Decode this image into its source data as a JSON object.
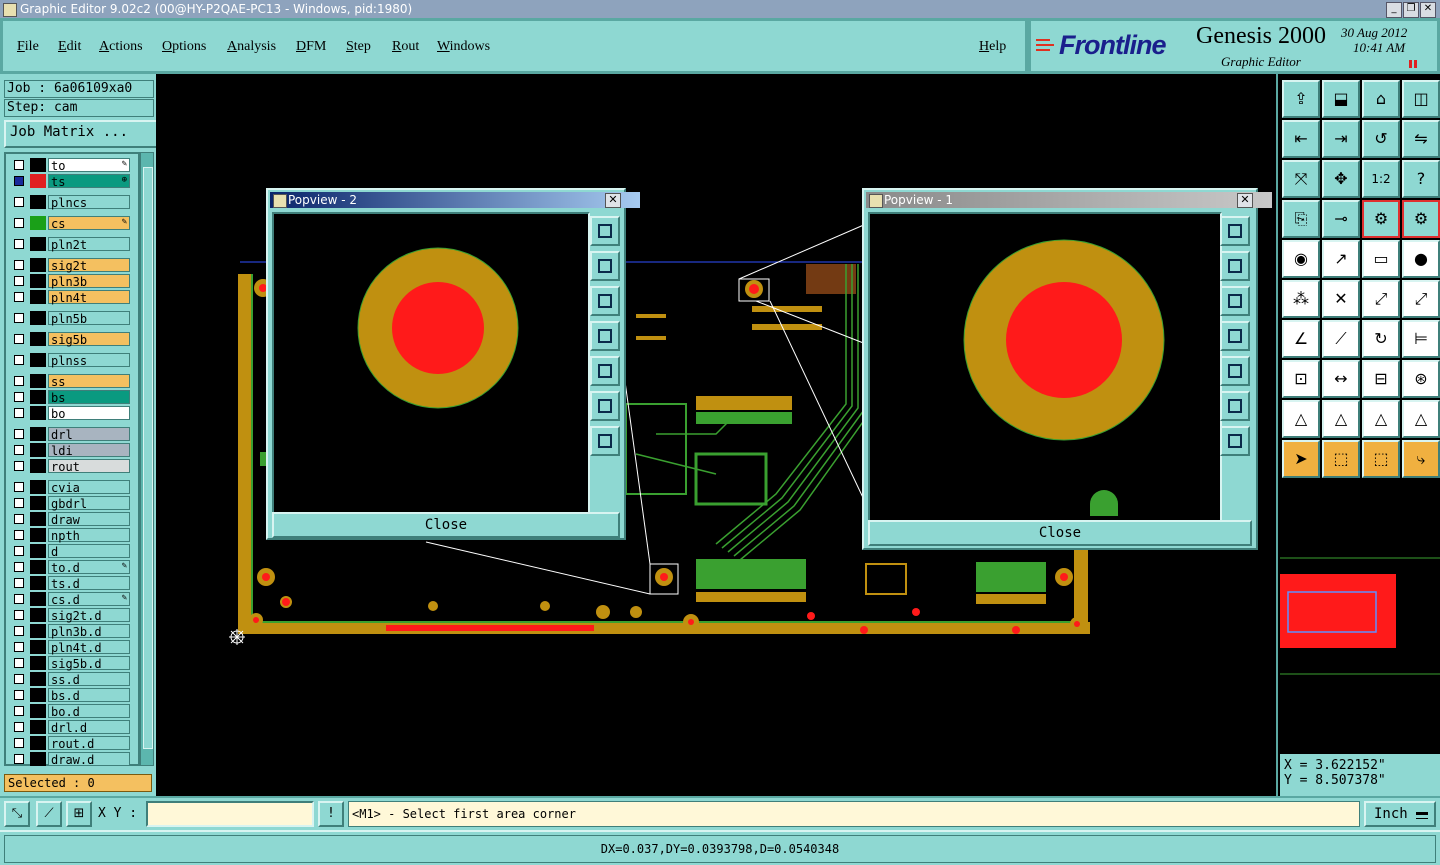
{
  "window": {
    "title": "Graphic Editor 9.02c2 (00@HY-P2QAE-PC13 - Windows, pid:1980)"
  },
  "menu": {
    "items": [
      "File",
      "Edit",
      "Actions",
      "Options",
      "Analysis",
      "DFM",
      "Step",
      "Rout",
      "Windows"
    ],
    "help": "Help"
  },
  "brand": {
    "logo": "Frontline",
    "product": "Genesis 2000",
    "subtitle": "Graphic Editor",
    "date": "30 Aug 2012",
    "time": "10:41 AM"
  },
  "job": {
    "job_label": "Job : 6a06109xa0",
    "step_label": "Step: cam",
    "matrix_button": "Job Matrix ..."
  },
  "layers": [
    {
      "name": "to",
      "color": "#000000",
      "bg": "#ffffff",
      "mark": "edit"
    },
    {
      "name": "ts",
      "color": "#e02020",
      "bg": "#0a9a80",
      "mark": "work"
    },
    {
      "name": "plncs",
      "color": "#000000",
      "bg": "#8ed8d2"
    },
    {
      "name": "cs",
      "color": "#1aa018",
      "bg": "#f4c060",
      "mark": "edit"
    },
    {
      "name": "pln2t",
      "color": "#000000",
      "bg": "#8ed8d2"
    },
    {
      "name": "sig2t",
      "color": "#000000",
      "bg": "#f4c060"
    },
    {
      "name": "pln3b",
      "color": "#000000",
      "bg": "#f4c060"
    },
    {
      "name": "pln4t",
      "color": "#000000",
      "bg": "#f4c060"
    },
    {
      "name": "pln5b",
      "color": "#000000",
      "bg": "#8ed8d2"
    },
    {
      "name": "sig5b",
      "color": "#000000",
      "bg": "#f4c060"
    },
    {
      "name": "plnss",
      "color": "#000000",
      "bg": "#8ed8d2"
    },
    {
      "name": "ss",
      "color": "#000000",
      "bg": "#f4c060"
    },
    {
      "name": "bs",
      "color": "#000000",
      "bg": "#0a9a80"
    },
    {
      "name": "bo",
      "color": "#000000",
      "bg": "#ffffff"
    },
    {
      "name": "drl",
      "color": "#000000",
      "bg": "#a8b4c0"
    },
    {
      "name": "ldi",
      "color": "#000000",
      "bg": "#a8b4c0"
    },
    {
      "name": "rout",
      "color": "#000000",
      "bg": "#d8dcdc"
    },
    {
      "name": "cvia",
      "color": "#000000",
      "bg": "#8ed8d2"
    },
    {
      "name": "gbdrl",
      "color": "#000000",
      "bg": "#8ed8d2"
    },
    {
      "name": "draw",
      "color": "#000000",
      "bg": "#8ed8d2"
    },
    {
      "name": "npth",
      "color": "#000000",
      "bg": "#8ed8d2"
    },
    {
      "name": "d",
      "color": "#000000",
      "bg": "#8ed8d2"
    },
    {
      "name": "to.d",
      "color": "#000000",
      "bg": "#8ed8d2",
      "mark": "edit"
    },
    {
      "name": "ts.d",
      "color": "#000000",
      "bg": "#8ed8d2"
    },
    {
      "name": "cs.d",
      "color": "#000000",
      "bg": "#8ed8d2",
      "mark": "edit"
    },
    {
      "name": "sig2t.d",
      "color": "#000000",
      "bg": "#8ed8d2"
    },
    {
      "name": "pln3b.d",
      "color": "#000000",
      "bg": "#8ed8d2"
    },
    {
      "name": "pln4t.d",
      "color": "#000000",
      "bg": "#8ed8d2"
    },
    {
      "name": "sig5b.d",
      "color": "#000000",
      "bg": "#8ed8d2"
    },
    {
      "name": "ss.d",
      "color": "#000000",
      "bg": "#8ed8d2"
    },
    {
      "name": "bs.d",
      "color": "#000000",
      "bg": "#8ed8d2"
    },
    {
      "name": "bo.d",
      "color": "#000000",
      "bg": "#8ed8d2"
    },
    {
      "name": "drl.d",
      "color": "#000000",
      "bg": "#8ed8d2"
    },
    {
      "name": "rout.d",
      "color": "#000000",
      "bg": "#8ed8d2"
    },
    {
      "name": "draw.d",
      "color": "#000000",
      "bg": "#8ed8d2"
    }
  ],
  "selected": "Selected : 0",
  "popview2": {
    "title": "Popview - 2",
    "close": "Close",
    "close_x": "✕"
  },
  "popview1": {
    "title": "Popview - 1",
    "close": "Close",
    "close_x": "✕"
  },
  "coords": {
    "x": "X = 3.622152\"",
    "y": "Y = 8.507378\""
  },
  "bottom": {
    "xy_label": "X Y :",
    "xy_value": "",
    "exclam": "!",
    "message": "<M1> - Select first area corner",
    "units": "Inch"
  },
  "status": "DX=0.037,DY=0.0393798,D=0.0540348",
  "colors": {
    "pad": "#c09010",
    "core": "#ff1a1a",
    "trace": "#3aa030",
    "panel": "#8ed8d2"
  }
}
